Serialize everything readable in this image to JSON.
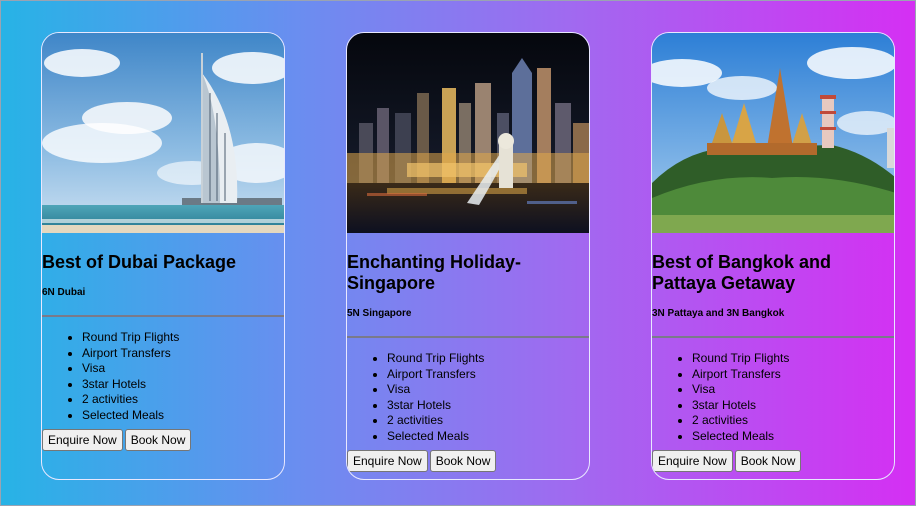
{
  "packages": [
    {
      "image_alt": "Burj Al Arab hotel on the beach in Dubai",
      "title": "Best of Dubai Package",
      "nights": "6N Dubai",
      "features": [
        "Round Trip Flights",
        "Airport Transfers",
        "Visa",
        "3star Hotels",
        "2 activities",
        "Selected Meals"
      ],
      "enquire_label": "Enquire Now",
      "book_label": "Book Now"
    },
    {
      "image_alt": "Singapore skyline at night with the Merlion fountain",
      "title": "Enchanting Holiday-Singapore",
      "nights": "5N Singapore",
      "features": [
        "Round Trip Flights",
        "Airport Transfers",
        "Visa",
        "3star Hotels",
        "2 activities",
        "Selected Meals"
      ],
      "enquire_label": "Enquire Now",
      "book_label": "Book Now"
    },
    {
      "image_alt": "Thai temple on a green hill under blue sky",
      "title": "Best of Bangkok and Pattaya Getaway",
      "nights": "3N Pattaya and 3N Bangkok",
      "features": [
        "Round Trip Flights",
        "Airport Transfers",
        "Visa",
        "3star Hotels",
        "2 activities",
        "Selected Meals"
      ],
      "enquire_label": "Enquire Now",
      "book_label": "Book Now"
    }
  ]
}
